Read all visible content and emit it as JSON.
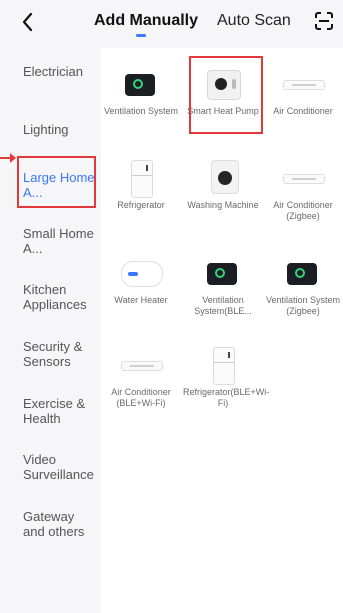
{
  "header": {
    "back_label": "<",
    "tabs": [
      {
        "label": "Add Manually",
        "active": true
      },
      {
        "label": "Auto Scan",
        "active": false
      }
    ],
    "scan_icon": "scan-icon"
  },
  "sidebar": {
    "items": [
      {
        "label": "Electrician"
      },
      {
        "label": "Lighting"
      },
      {
        "label": "Large Home A...",
        "active": true
      },
      {
        "label": "Small Home A..."
      },
      {
        "label": "Kitchen Appliances"
      },
      {
        "label": "Security & Sensors"
      },
      {
        "label": "Exercise & Health"
      },
      {
        "label": "Video Surveillance"
      },
      {
        "label": "Gateway and others"
      }
    ]
  },
  "devices": [
    {
      "label": "Ventilation System",
      "icon": "ventilation-icon"
    },
    {
      "label": "Smart Heat Pump",
      "icon": "heat-pump-icon"
    },
    {
      "label": "Air Conditioner",
      "icon": "ac-icon"
    },
    {
      "label": "Refrigerator",
      "icon": "fridge-icon"
    },
    {
      "label": "Washing Machine",
      "icon": "washer-icon"
    },
    {
      "label": "Air Conditioner (Zigbee)",
      "icon": "ac-icon"
    },
    {
      "label": "Water Heater",
      "icon": "water-heater-icon"
    },
    {
      "label": "Ventilation System(BLE...",
      "icon": "ventilation-icon"
    },
    {
      "label": "Ventilation System (Zigbee)",
      "icon": "ventilation-icon"
    },
    {
      "label": "Air Conditioner (BLE+Wi-Fi)",
      "icon": "ac-icon"
    },
    {
      "label": "Refrigerator(BLE+Wi-Fi)",
      "icon": "fridge-icon"
    }
  ],
  "colors": {
    "accent": "#3a77ff",
    "highlight": "#e23a3a",
    "label_gray": "#6a6a6a",
    "category_text": "#555555",
    "content_bg": "#ffffff",
    "sidebar_bg": "#f6f6f8"
  }
}
